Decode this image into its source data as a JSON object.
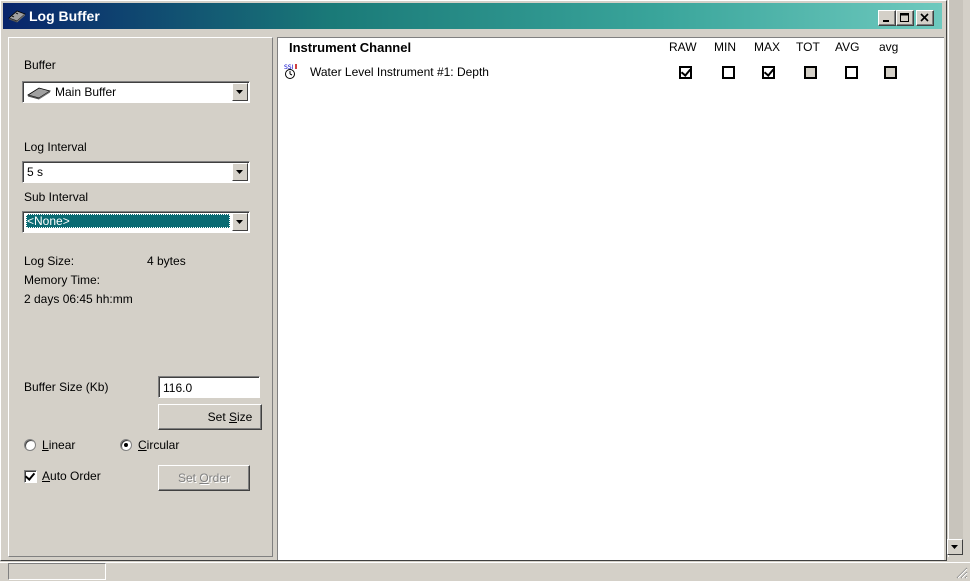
{
  "window": {
    "title": "Log Buffer"
  },
  "left": {
    "buffer_label": "Buffer",
    "buffer_value": "Main Buffer",
    "log_interval_label": "Log Interval",
    "log_interval_value": "5 s",
    "sub_interval_label": "Sub Interval",
    "sub_interval_value": "<None>",
    "log_size_label": "Log Size:",
    "log_size_value": "4 bytes",
    "memory_time_label": "Memory Time:",
    "memory_time_value": "2 days 06:45 hh:mm",
    "buffer_size_label": "Buffer Size (Kb)",
    "buffer_size_value": "116.0",
    "set_size_prefix": "Set ",
    "set_size_accel": "S",
    "set_size_suffix": "ize",
    "linear_accel": "L",
    "linear_rest": "inear",
    "circular_accel": "C",
    "circular_rest": "ircular",
    "mode_selected": "circular",
    "auto_order_accel": "A",
    "auto_order_rest": "uto Order",
    "auto_order_checked": true,
    "set_order_prefix": "Set ",
    "set_order_accel": "O",
    "set_order_suffix": "rder"
  },
  "list": {
    "header": "Instrument Channel",
    "columns": [
      "RAW",
      "MIN",
      "MAX",
      "TOT",
      "AVG",
      "avg"
    ],
    "rows": [
      {
        "name": "Water Level Instrument #1: Depth",
        "icon": "instrument-sensor-icon",
        "checks": [
          {
            "checked": true,
            "gray": false
          },
          {
            "checked": false,
            "gray": false
          },
          {
            "checked": true,
            "gray": false
          },
          {
            "checked": false,
            "gray": true
          },
          {
            "checked": false,
            "gray": false
          },
          {
            "checked": false,
            "gray": true
          }
        ]
      }
    ]
  },
  "colors": {
    "title_gradient_start": "#08246b",
    "title_gradient_end": "#6ec9be",
    "selection": "#0a6b73",
    "face": "#d4d0c8"
  }
}
